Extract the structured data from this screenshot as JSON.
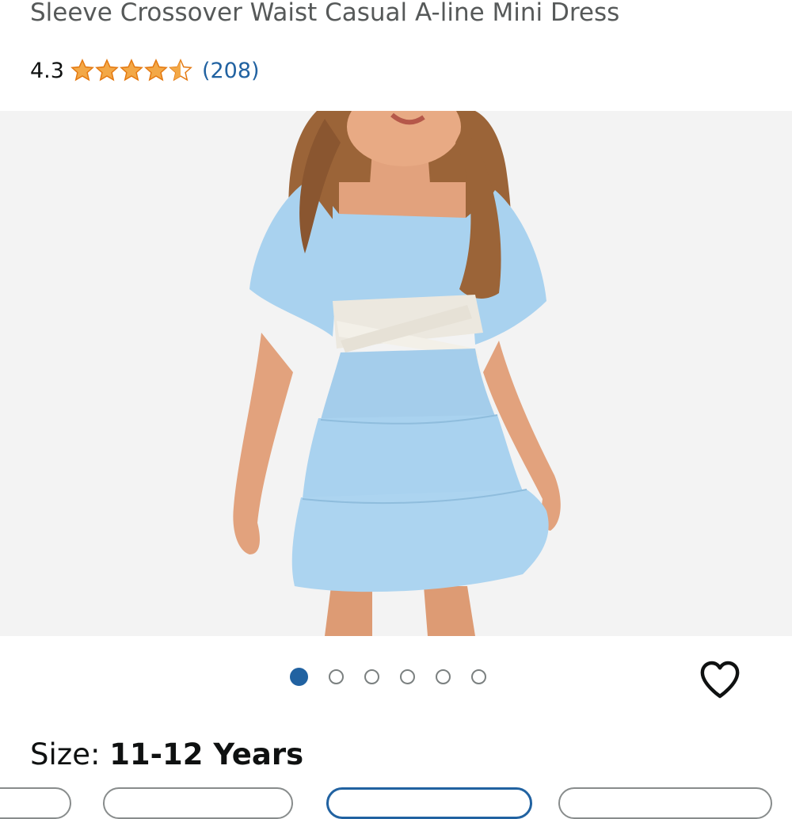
{
  "product": {
    "title": "Sleeve Crossover Waist Casual A-line Mini Dress",
    "rating_value": "4.3",
    "rating_stars": 4.3,
    "rating_count": "(208)"
  },
  "carousel": {
    "image_alt": "Girl wearing light blue tiered mini dress with white crossover waist",
    "dot_count": 6,
    "active_index": 0
  },
  "size": {
    "label": "Size: ",
    "value": "11-12 Years"
  },
  "colors": {
    "star": "#f3a847",
    "star_stroke": "#e47911",
    "link": "#2162a1",
    "dress": "#a9d2ef",
    "skin": "#e2a27d",
    "hair": "#9b6438"
  }
}
